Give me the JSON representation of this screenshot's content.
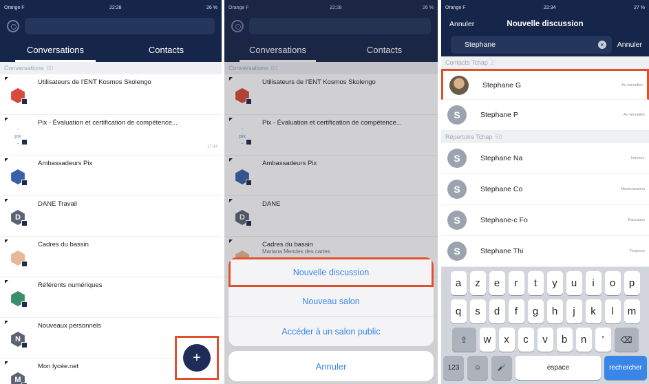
{
  "statusbars": [
    {
      "carrier": "Orange F",
      "time": "22:28",
      "battery": "26 %"
    },
    {
      "carrier": "Orange F",
      "time": "22:28",
      "battery": "26 %"
    },
    {
      "carrier": "Orange F",
      "time": "22:34",
      "battery": "27 %"
    }
  ],
  "tabs": {
    "conversations": "Conversations",
    "contacts": "Contacts"
  },
  "section": {
    "label": "Conversations",
    "count": "60"
  },
  "conversations": [
    {
      "title": "Utilisateurs de l'ENT Kosmos Skolengo",
      "time": "",
      "color": "#d84a3a",
      "icon": "kosmos-logo-icon"
    },
    {
      "title": "Pix - Évaluation et certification de compétence...",
      "time": "17:44",
      "color": "#8aa6d4",
      "icon": "pix-logo-icon"
    },
    {
      "title": "Ambassadeurs Pix",
      "time": "",
      "color": "#3b5fa8",
      "icon": "ambassadeurs-icon"
    },
    {
      "title": "DANE Travail",
      "time": "",
      "color": "#5b6373",
      "icon": "hexagon-d-icon"
    },
    {
      "title": "Cadres du bassin",
      "time": "",
      "color": "#e7b896",
      "icon": "cadres-icon"
    },
    {
      "title": "Référents numériques",
      "time": "",
      "color": "#3a8f6a",
      "icon": "referents-icon"
    },
    {
      "title": "Nouveaux personnels",
      "time": "",
      "color": "#5b6373",
      "icon": "hexagon-n-icon"
    },
    {
      "title": "Mon lycée.net",
      "time": "",
      "color": "#5b6373",
      "icon": "hexagon-m-icon"
    }
  ],
  "avatar_letters": [
    "",
    "",
    "",
    "D",
    "",
    "",
    "N",
    "M"
  ],
  "pix_logo_text": "pix",
  "fab_label": "+",
  "panel2": {
    "conversations": [
      {
        "title": "Utilisateurs de l'ENT Kosmos Skolengo"
      },
      {
        "title": "Pix - Évaluation et certification de compétence..."
      },
      {
        "title": "Ambassadeurs Pix"
      },
      {
        "title": "DANE"
      },
      {
        "title": "Cadres du bassin",
        "sub": "Mariana Mendes des cartes"
      }
    ],
    "actions": [
      "Nouvelle discussion",
      "Nouveau salon",
      "Accéder à un salon public"
    ],
    "cancel": "Annuler"
  },
  "panel3": {
    "nav_cancel": "Annuler",
    "title": "Nouvelle discussion",
    "search_value": "Stephane",
    "search_cancel": "Annuler",
    "section_contacts": {
      "label": "Contacts Tchap",
      "count": "2"
    },
    "contacts": [
      {
        "name": "Stephane G",
        "tag": "Ac-versailles",
        "initial": "",
        "photo": true
      },
      {
        "name": "Stephane P",
        "tag": "Ac-versailles",
        "initial": "S",
        "photo": false
      }
    ],
    "section_directory": {
      "label": "Répertoire Tchap",
      "count": "50"
    },
    "directory": [
      {
        "name": "Stephane Na",
        "tag": "Interieur",
        "initial": "S"
      },
      {
        "name": "Stephane Co",
        "tag": "Modernisation",
        "initial": "S"
      },
      {
        "name": "Stephane-c Fo",
        "tag": "Education",
        "initial": "S"
      },
      {
        "name": "Stephane Thi",
        "tag": "Finances",
        "initial": "S"
      }
    ],
    "keyboard": {
      "row1": [
        "a",
        "z",
        "e",
        "r",
        "t",
        "y",
        "u",
        "i",
        "o",
        "p"
      ],
      "row2": [
        "q",
        "s",
        "d",
        "f",
        "g",
        "h",
        "j",
        "k",
        "l",
        "m"
      ],
      "row3": [
        "w",
        "x",
        "c",
        "v",
        "b",
        "n",
        "'"
      ],
      "shift": "⇧",
      "backspace": "⌫",
      "numbers": "123",
      "emoji": "☺",
      "mic": "🎤",
      "space": "espace",
      "go": "rechercher"
    }
  }
}
